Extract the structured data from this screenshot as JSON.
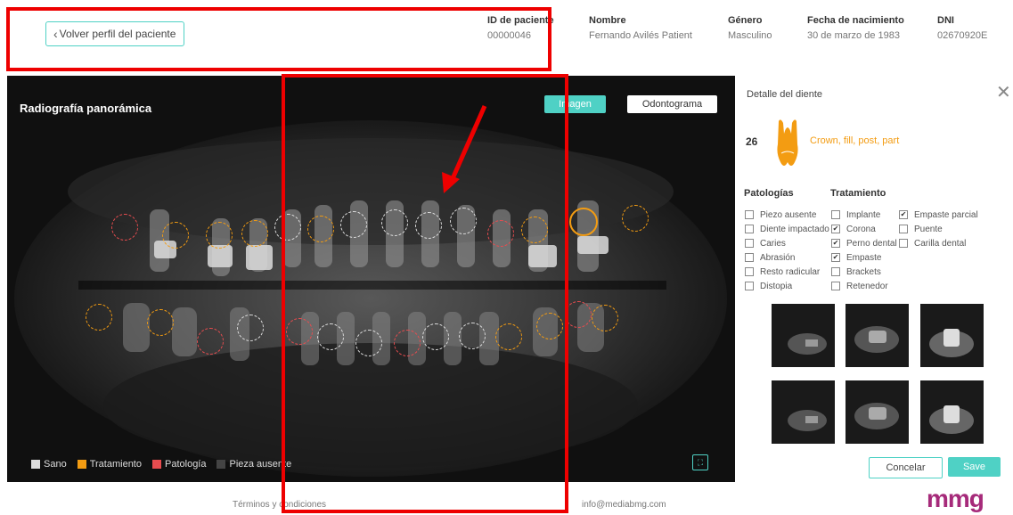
{
  "header": {
    "back_label": "Volver perfil del paciente",
    "fields": [
      {
        "label": "ID de paciente",
        "value": "00000046"
      },
      {
        "label": "Nombre",
        "value": "Fernando Avilés Patient"
      },
      {
        "label": "Género",
        "value": "Masculino"
      },
      {
        "label": "Fecha de nacimiento",
        "value": "30 de marzo de 1983"
      },
      {
        "label": "DNI",
        "value": "02670920E"
      }
    ]
  },
  "xray": {
    "title": "Radiografía panorámica",
    "tab_imagen": "Imagen",
    "tab_odontograma": "Odontograma",
    "legend": [
      {
        "label": "Sano",
        "color": "#dddddd"
      },
      {
        "label": "Tratamiento",
        "color": "#f39c12"
      },
      {
        "label": "Patología",
        "color": "#e84c4f"
      },
      {
        "label": "Pieza ausente",
        "color": "#444444"
      }
    ]
  },
  "panel": {
    "title": "Detalle del diente",
    "tooth_number": "26",
    "tooth_description": "Crown, fill, post, part",
    "pathologies_title": "Patologías",
    "treatment_title": "Tratamiento",
    "pathologies": [
      {
        "label": "Piezo ausente",
        "checked": false
      },
      {
        "label": "Diente impactado",
        "checked": false
      },
      {
        "label": "Caries",
        "checked": false
      },
      {
        "label": "Abrasión",
        "checked": false
      },
      {
        "label": "Resto radicular",
        "checked": false
      },
      {
        "label": "Distopia",
        "checked": false
      }
    ],
    "treatments_col1": [
      {
        "label": "Implante",
        "checked": false
      },
      {
        "label": "Corona",
        "checked": true
      },
      {
        "label": "Perno dental",
        "checked": true
      },
      {
        "label": "Empaste",
        "checked": true
      },
      {
        "label": "Brackets",
        "checked": false
      },
      {
        "label": "Retenedor",
        "checked": false
      }
    ],
    "treatments_col2": [
      {
        "label": "Empaste parcial",
        "checked": true
      },
      {
        "label": "Puente",
        "checked": false
      },
      {
        "label": "Carilla dental",
        "checked": false
      }
    ],
    "cancel_label": "Concelar",
    "save_label": "Save"
  },
  "footer": {
    "terms": "Términos y condiciones",
    "email": "info@mediabmg.com",
    "logo": "mmg"
  },
  "colors": {
    "accent": "#4fd1c5",
    "treatment": "#f39c12",
    "pathology": "#e84c4f",
    "annotation": "#ee0000"
  }
}
